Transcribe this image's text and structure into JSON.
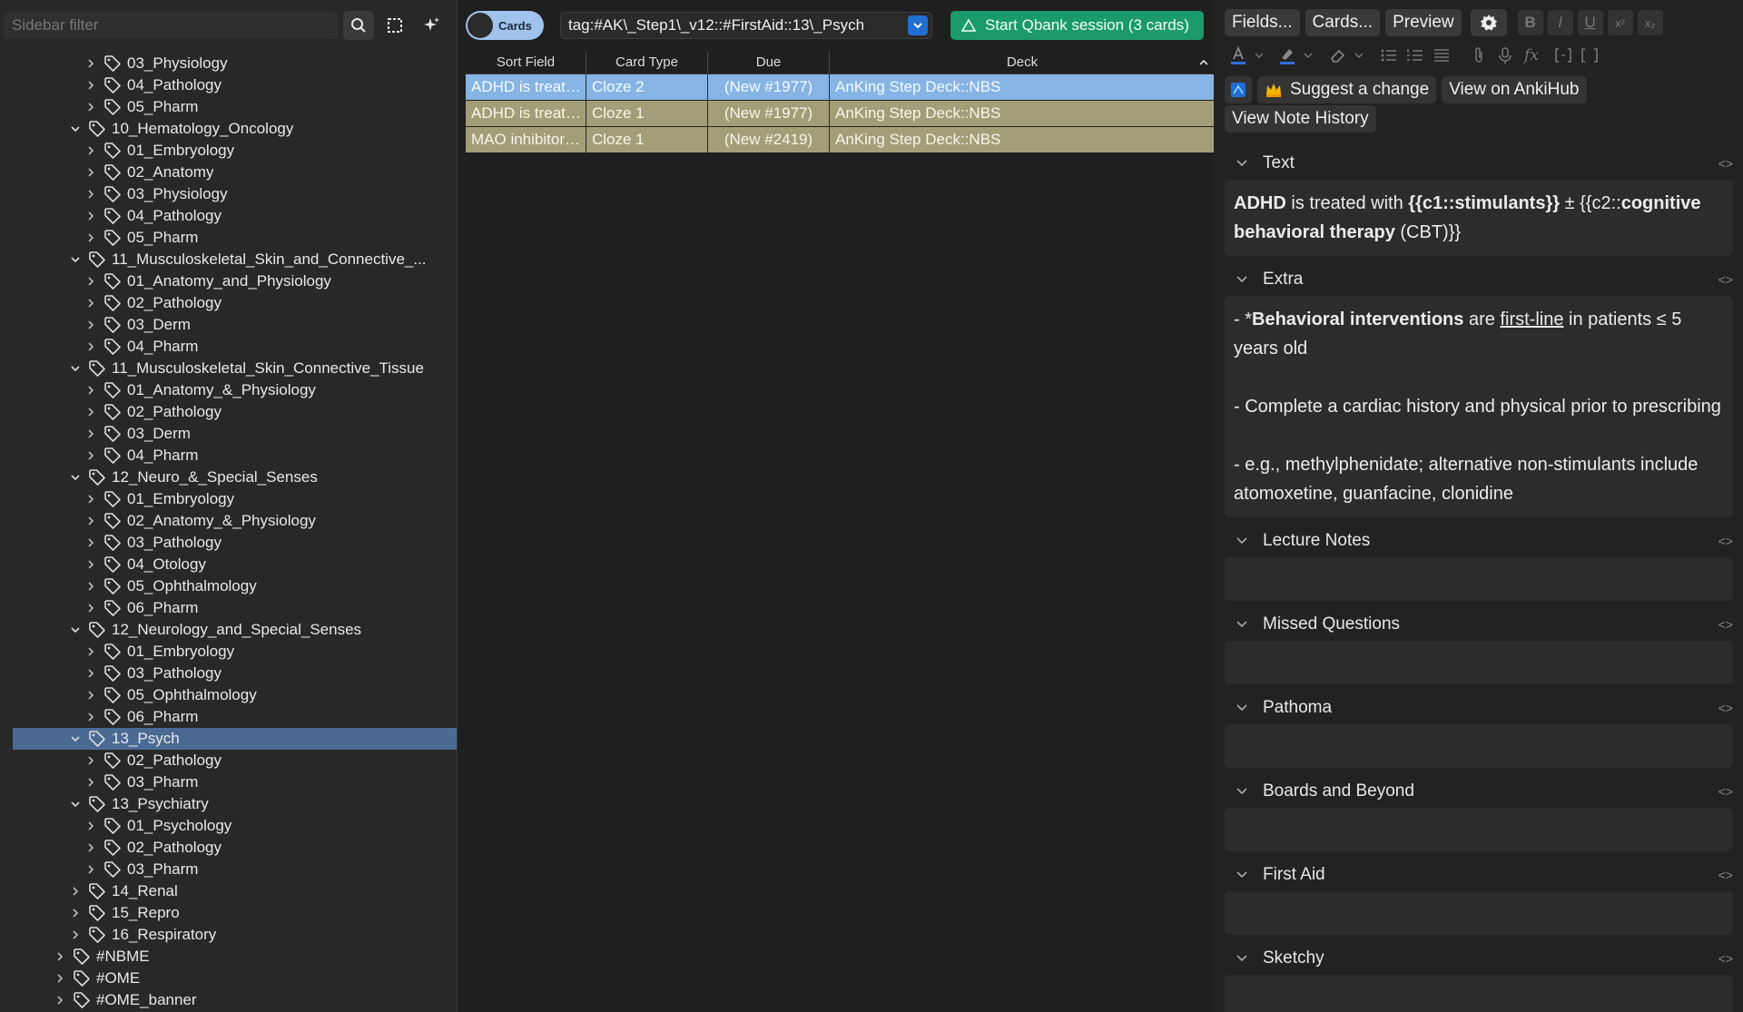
{
  "sidebar": {
    "filter_placeholder": "Sidebar filter",
    "items": [
      {
        "label": "03_Physiology",
        "level": 2,
        "expanded": false
      },
      {
        "label": "04_Pathology",
        "level": 2,
        "expanded": false
      },
      {
        "label": "05_Pharm",
        "level": 2,
        "expanded": false
      },
      {
        "label": "10_Hematology_Oncology",
        "level": 1,
        "expanded": true
      },
      {
        "label": "01_Embryology",
        "level": 2,
        "expanded": false
      },
      {
        "label": "02_Anatomy",
        "level": 2,
        "expanded": false
      },
      {
        "label": "03_Physiology",
        "level": 2,
        "expanded": false
      },
      {
        "label": "04_Pathology",
        "level": 2,
        "expanded": false
      },
      {
        "label": "05_Pharm",
        "level": 2,
        "expanded": false
      },
      {
        "label": "11_Musculoskeletal_Skin_and_Connective_...",
        "level": 1,
        "expanded": true
      },
      {
        "label": "01_Anatomy_and_Physiology",
        "level": 2,
        "expanded": false
      },
      {
        "label": "02_Pathology",
        "level": 2,
        "expanded": false
      },
      {
        "label": "03_Derm",
        "level": 2,
        "expanded": false
      },
      {
        "label": "04_Pharm",
        "level": 2,
        "expanded": false
      },
      {
        "label": "11_Musculoskeletal_Skin_Connective_Tissue",
        "level": 1,
        "expanded": true
      },
      {
        "label": "01_Anatomy_&_Physiology",
        "level": 2,
        "expanded": false
      },
      {
        "label": "02_Pathology",
        "level": 2,
        "expanded": false
      },
      {
        "label": "03_Derm",
        "level": 2,
        "expanded": false
      },
      {
        "label": "04_Pharm",
        "level": 2,
        "expanded": false
      },
      {
        "label": "12_Neuro_&_Special_Senses",
        "level": 1,
        "expanded": true
      },
      {
        "label": "01_Embryology",
        "level": 2,
        "expanded": false
      },
      {
        "label": "02_Anatomy_&_Physiology",
        "level": 2,
        "expanded": false
      },
      {
        "label": "03_Pathology",
        "level": 2,
        "expanded": false
      },
      {
        "label": "04_Otology",
        "level": 2,
        "expanded": false
      },
      {
        "label": "05_Ophthalmology",
        "level": 2,
        "expanded": false
      },
      {
        "label": "06_Pharm",
        "level": 2,
        "expanded": false
      },
      {
        "label": "12_Neurology_and_Special_Senses",
        "level": 1,
        "expanded": true
      },
      {
        "label": "01_Embryology",
        "level": 2,
        "expanded": false
      },
      {
        "label": "03_Pathology",
        "level": 2,
        "expanded": false
      },
      {
        "label": "05_Ophthalmology",
        "level": 2,
        "expanded": false
      },
      {
        "label": "06_Pharm",
        "level": 2,
        "expanded": false
      },
      {
        "label": "13_Psych",
        "level": 1,
        "expanded": true,
        "selected": true
      },
      {
        "label": "02_Pathology",
        "level": 2,
        "expanded": false
      },
      {
        "label": "03_Pharm",
        "level": 2,
        "expanded": false
      },
      {
        "label": "13_Psychiatry",
        "level": 1,
        "expanded": true
      },
      {
        "label": "01_Psychology",
        "level": 2,
        "expanded": false
      },
      {
        "label": "02_Pathology",
        "level": 2,
        "expanded": false
      },
      {
        "label": "03_Pharm",
        "level": 2,
        "expanded": false
      },
      {
        "label": "14_Renal",
        "level": 1,
        "expanded": false
      },
      {
        "label": "15_Repro",
        "level": 1,
        "expanded": false
      },
      {
        "label": "16_Respiratory",
        "level": 1,
        "expanded": false
      },
      {
        "label": "#NBME",
        "level": 0,
        "expanded": false
      },
      {
        "label": "#OME",
        "level": 0,
        "expanded": false
      },
      {
        "label": "#OME_banner",
        "level": 0,
        "expanded": false
      }
    ]
  },
  "toolbar": {
    "toggle_label": "Cards",
    "search_value": "tag:#AK\\_Step1\\_v12::#FirstAid::13\\_Psych",
    "qbank_label": "Start Qbank session (3 cards)"
  },
  "table": {
    "headers": [
      "Sort Field",
      "Card Type",
      "Due",
      "Deck"
    ],
    "rows": [
      {
        "sort_field": "ADHD is treat…",
        "card_type": "Cloze 2",
        "due": "(New #1977)",
        "deck": "AnKing Step Deck::NBS",
        "state": "selected"
      },
      {
        "sort_field": "ADHD is treat…",
        "card_type": "Cloze 1",
        "due": "(New #1977)",
        "deck": "AnKing Step Deck::NBS",
        "state": "olive"
      },
      {
        "sort_field": "MAO inhibitor…",
        "card_type": "Cloze 1",
        "due": "(New #2419)",
        "deck": "AnKing Step Deck::NBS",
        "state": "olive"
      }
    ]
  },
  "editor": {
    "top_buttons": {
      "fields": "Fields...",
      "cards": "Cards...",
      "preview": "Preview"
    },
    "format_buttons": {
      "bold": "B",
      "italic": "I",
      "underline": "U",
      "sup": "x²",
      "sub": "x₂"
    },
    "hub_buttons": {
      "suggest": "Suggest a change",
      "view_hub": "View on AnkiHub",
      "history": "View Note History"
    },
    "fields": {
      "text": {
        "name": "Text",
        "parts": {
          "p1": "ADHD",
          "p2": " is treated with ",
          "p3": "{{c1::stimulants}}",
          "p4": " ± {{c2::",
          "p5": "cognitive behavioral therapy",
          "p6": " (CBT)}}"
        }
      },
      "extra": {
        "name": "Extra",
        "line1": {
          "a": "- *",
          "b": "Behavioral interventions",
          "c": " are ",
          "d": "first-line",
          "e": " in patients ≤ 5 years old"
        },
        "line2": "- Complete a cardiac history and physical prior to prescribing",
        "line3": "- e.g., methylphenidate; alternative non-stimulants include atomoxetine, guanfacine, clonidine"
      },
      "lecture_notes": {
        "name": "Lecture Notes"
      },
      "missed_questions": {
        "name": "Missed Questions"
      },
      "pathoma": {
        "name": "Pathoma"
      },
      "boards_beyond": {
        "name": "Boards and Beyond"
      },
      "first_aid": {
        "name": "First Aid"
      },
      "sketchy": {
        "name": "Sketchy"
      }
    },
    "code_toggle": "<>"
  },
  "colors": {
    "selected_row": "#86b4e4",
    "olive_row": "#a39e78",
    "qbank_green": "#1b9a6b",
    "sidebar_selected": "#4a6a94"
  }
}
